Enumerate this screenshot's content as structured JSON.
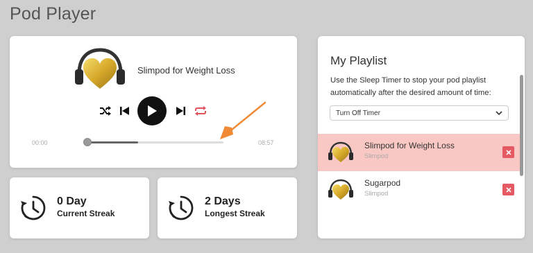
{
  "page": {
    "title": "Pod Player"
  },
  "player": {
    "track_title": "Slimpod for Weight Loss",
    "time_current": "00:00",
    "time_total": "08:57",
    "progress_fraction": 0.0,
    "buffered_fraction": 0.37,
    "icons": [
      "headphones-heart-icon",
      "shuffle-icon",
      "previous-icon",
      "play-icon",
      "next-icon",
      "repeat-icon"
    ],
    "repeat_color": "#e0515a"
  },
  "streaks": [
    {
      "value": "0 Day",
      "label": "Current Streak"
    },
    {
      "value": "2 Days",
      "label": "Longest Streak"
    }
  ],
  "playlist": {
    "title": "My Playlist",
    "description": "Use the Sleep Timer to stop your pod playlist automatically after the desired amount of time:",
    "timer_selected": "Turn Off Timer",
    "items": [
      {
        "name": "Slimpod for Weight Loss",
        "subtitle": "Slimpod",
        "active": true
      },
      {
        "name": "Sugarpod",
        "subtitle": "Slimpod",
        "active": false
      }
    ],
    "active_color": "#f9c8c4",
    "remove_color": "#e55a62"
  },
  "annotation": {
    "arrow_color": "#f08a36"
  }
}
